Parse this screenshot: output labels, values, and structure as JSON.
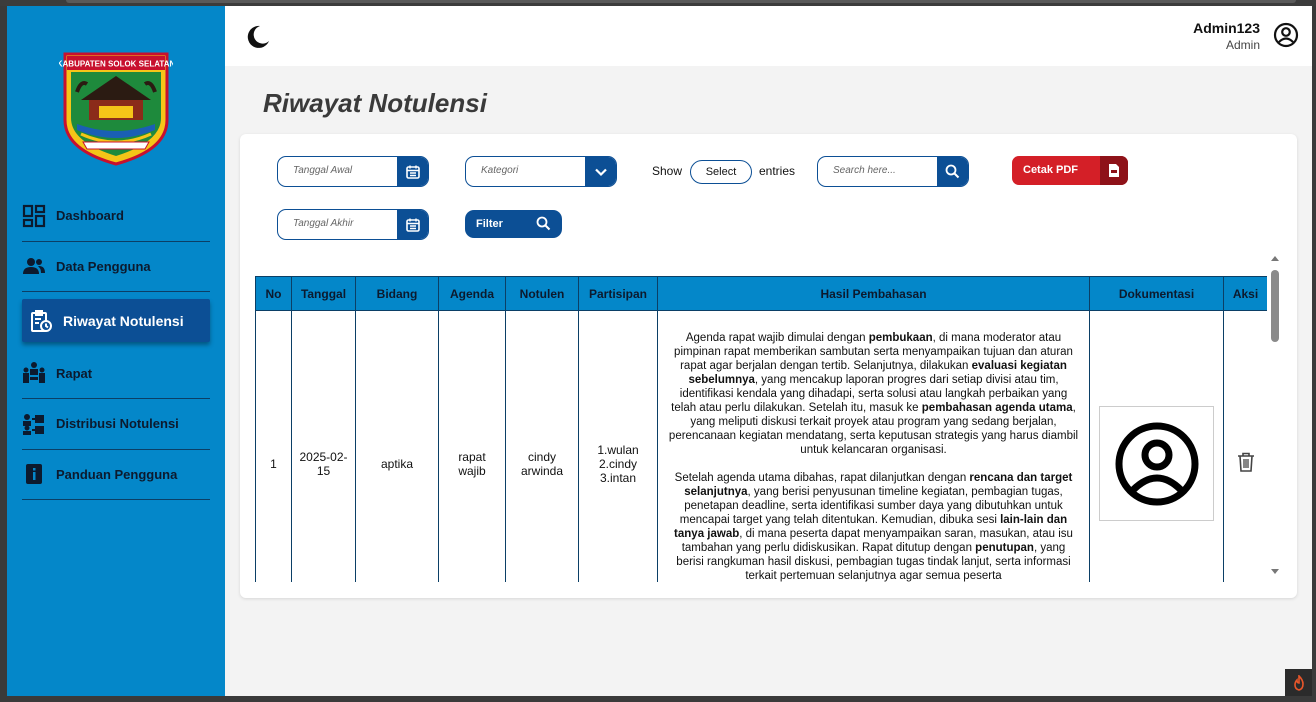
{
  "sidebar": {
    "logo_text": "KABUPATEN SOLOK SELATAN",
    "items": [
      {
        "label": "Dashboard",
        "icon": "dashboard-icon",
        "active": false
      },
      {
        "label": "Data Pengguna",
        "icon": "users-icon",
        "active": false
      },
      {
        "label": "Riwayat Notulensi",
        "icon": "history-clipboard-icon",
        "active": true
      },
      {
        "label": "Rapat",
        "icon": "meeting-icon",
        "active": false
      },
      {
        "label": "Distribusi Notulensi",
        "icon": "distribution-icon",
        "active": false
      },
      {
        "label": "Panduan Pengguna",
        "icon": "guide-icon",
        "active": false
      }
    ]
  },
  "header": {
    "user_name": "Admin123",
    "user_role": "Admin"
  },
  "page": {
    "title": "Riwayat Notulensi"
  },
  "filters": {
    "start_date_placeholder": "Tanggal Awal",
    "end_date_placeholder": "Tanggal Akhir",
    "category_placeholder": "Kategori",
    "filter_label": "Filter",
    "show_label": "Show",
    "entries_select": "Select",
    "entries_label": "entries",
    "search_placeholder": "Search here...",
    "pdf_label": "Cetak PDF"
  },
  "table": {
    "headers": [
      "No",
      "Tanggal",
      "Bidang",
      "Agenda",
      "Notulen",
      "Partisipan",
      "Hasil Pembahasan",
      "Dokumentasi",
      "Aksi"
    ],
    "rows": [
      {
        "no": "1",
        "tanggal": "2025-02-15",
        "bidang": "aptika",
        "agenda": "rapat wajib",
        "notulen": "cindy arwinda",
        "partisipan": [
          "1.wulan",
          "2.cindy",
          "3.intan"
        ],
        "hasil_p1": [
          "Agenda rapat wajib dimulai dengan ",
          "pembukaan",
          ", di mana moderator atau pimpinan rapat memberikan sambutan serta menyampaikan tujuan dan aturan rapat agar berjalan dengan tertib. Selanjutnya, dilakukan ",
          "evaluasi kegiatan sebelumnya",
          ", yang mencakup laporan progres dari setiap divisi atau tim, identifikasi kendala yang dihadapi, serta solusi atau langkah perbaikan yang telah atau perlu dilakukan. Setelah itu, masuk ke ",
          "pembahasan agenda utama",
          ", yang meliputi diskusi terkait proyek atau program yang sedang berjalan, perencanaan kegiatan mendatang, serta keputusan strategis yang harus diambil untuk kelancaran organisasi."
        ],
        "hasil_p2": [
          "Setelah agenda utama dibahas, rapat dilanjutkan dengan ",
          "rencana dan target selanjutnya",
          ", yang berisi penyusunan timeline kegiatan, pembagian tugas, penetapan deadline, serta identifikasi sumber daya yang dibutuhkan untuk mencapai target yang telah ditentukan. Kemudian, dibuka sesi ",
          "lain-lain dan tanya jawab",
          ", di mana peserta dapat menyampaikan saran, masukan, atau isu tambahan yang perlu didiskusikan. Rapat ditutup dengan ",
          "penutupan",
          ", yang berisi rangkuman hasil diskusi, pembagian tugas tindak lanjut, serta informasi terkait pertemuan selanjutnya agar semua peserta"
        ],
        "dokumentasi_icon": "user-circle-icon",
        "aksi_icon": "trash-icon"
      }
    ]
  },
  "colors": {
    "sidebar": "#0487c9",
    "primary": "#0c4f95",
    "pdf": "#d41f27"
  }
}
